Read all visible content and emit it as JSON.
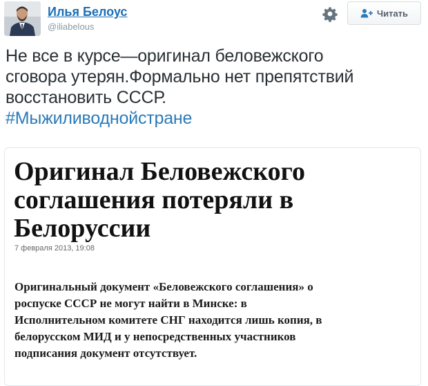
{
  "author": {
    "name": "Илья Белоус",
    "handle": "@iliabelous"
  },
  "actions": {
    "settings_icon": "gear-icon",
    "follow_label": "Читать",
    "follow_icon": "follow-person-icon"
  },
  "tweet": {
    "lines": [
      "Не все в курсе—оригинал беловежского",
      "сговора утерян.Формально нет препятствий",
      "восстановить СССР."
    ],
    "hashtag": "#Мыжиливоднойстране"
  },
  "article": {
    "title_lines": [
      "Оригинал Беловежского",
      "соглашения потеряли в",
      "Белоруссии"
    ],
    "date": "7 февраля 2013, 19:08",
    "lead_lines": [
      "Оригинальный документ «Беловежского соглашения» о",
      "роспуске СССР не могут найти в Минске: в",
      "Исполнительном комитете СНГ находится лишь копия, в",
      "белорусском МИД и у непосредственных участников",
      "подписания документ отсутствует."
    ]
  },
  "colors": {
    "name": "#1b6fb6",
    "hashtag": "#2b7bb9",
    "handle": "#8899a6",
    "text": "#292f33"
  }
}
